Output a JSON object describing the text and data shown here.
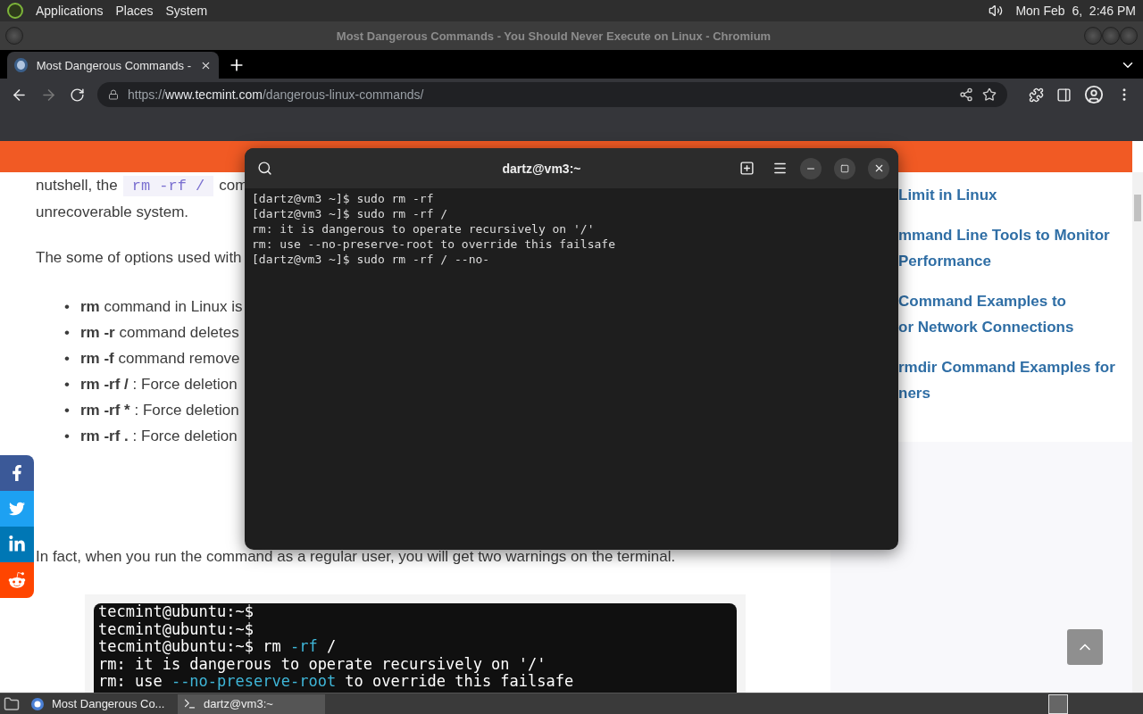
{
  "top_panel": {
    "menus": [
      "Applications",
      "Places",
      "System"
    ],
    "clock": "Mon Feb  6,  2:46 PM"
  },
  "window": {
    "title": "Most Dangerous Commands - You Should Never Execute on Linux - Chromium"
  },
  "tabs": [
    {
      "label": "Most Dangerous Commands -",
      "selected": true
    }
  ],
  "address": {
    "scheme": "https://",
    "host": "www.tecmint.com",
    "path": "/dangerous-linux-commands/"
  },
  "article": {
    "intro_start": "nutshell, the",
    "intro_code": "rm -rf /",
    "intro_end": "com",
    "intro_line_2": "unrecoverable system.",
    "options_intro": "The some of options used with",
    "options": [
      {
        "marker": "•",
        "term": "rm",
        "text": " command in Linux is"
      },
      {
        "marker": "•",
        "term": "rm -r",
        "text": " command deletes"
      },
      {
        "marker": "•",
        "term": "rm -f",
        "text": " command remove"
      },
      {
        "marker": "•",
        "term": "rm -rf /",
        "text": " : Force deletion"
      },
      {
        "marker": "•",
        "term": "rm -rf *",
        "text": " : Force deletion"
      },
      {
        "marker": "•",
        "term": "rm -rf .",
        "text": " : Force deletion"
      }
    ],
    "note": "In fact, when you run the command as a regular user, you will get two warnings on the terminal.",
    "screenshot_lines": [
      {
        "parts": [
          {
            "text": "tecmint@ubuntu:~$",
            "highlight": false
          }
        ]
      },
      {
        "parts": [
          {
            "text": "tecmint@ubuntu:~$",
            "highlight": false
          }
        ]
      },
      {
        "parts": [
          {
            "text": "tecmint@ubuntu:~$ rm ",
            "highlight": false
          },
          {
            "text": "-rf",
            "highlight": true
          },
          {
            "text": " /",
            "highlight": false
          }
        ]
      },
      {
        "parts": [
          {
            "text": "rm: it is dangerous to operate recursively on '/'",
            "highlight": false
          }
        ]
      },
      {
        "parts": [
          {
            "text": "rm: use ",
            "highlight": false
          },
          {
            "text": "--no-preserve-root",
            "highlight": true
          },
          {
            "text": " to override this failsafe",
            "highlight": false
          }
        ]
      }
    ]
  },
  "sidebar": {
    "links": [
      [
        "Limit in Linux"
      ],
      [
        "mmand Line Tools to Monitor",
        "Performance"
      ],
      [
        "Command Examples to",
        "or Network Connections"
      ],
      [
        "rmdir Command Examples for",
        "ners"
      ]
    ]
  },
  "share_buttons": [
    {
      "kind": "facebook",
      "color": "#3b5998"
    },
    {
      "kind": "twitter",
      "color": "#1da1f2"
    },
    {
      "kind": "linkedin",
      "color": "#0077b5"
    },
    {
      "kind": "reddit",
      "color": "#ff4500"
    }
  ],
  "terminal": {
    "title": "dartz@vm3:~",
    "lines": [
      "[dartz@vm3 ~]$ sudo rm -rf",
      "[dartz@vm3 ~]$ sudo rm -rf /",
      "rm: it is dangerous to operate recursively on '/'",
      "rm: use --no-preserve-root to override this failsafe",
      "[dartz@vm3 ~]$ sudo rm -rf / --no-"
    ]
  },
  "taskbar": {
    "tasks": [
      {
        "kind": "browser",
        "label": "Most Dangerous Co...",
        "selected": false
      },
      {
        "kind": "terminal",
        "label": "dartz@vm3:~",
        "selected": true
      }
    ]
  }
}
